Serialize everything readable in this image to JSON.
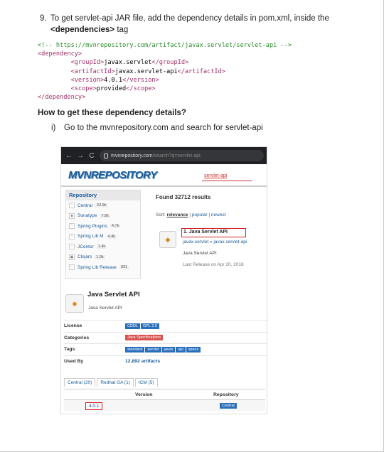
{
  "step": {
    "number": "9.",
    "text_a": "To get servlet-api JAR file, add the dependency details in pom.xml, inside the",
    "text_bold": "<dependencies>",
    "text_b": " tag"
  },
  "code": {
    "comment": "<!-- https://mvnrepository.com/artifact/javax.servlet/servlet-api -->",
    "open_dependency": "<dependency>",
    "groupId_open": "<groupId>",
    "groupId_value": "javax.servlet",
    "groupId_close": "</groupId>",
    "artifactId_open": "<artifactId>",
    "artifactId_value": "javax.servlet-api",
    "artifactId_close": "</artifactId>",
    "version_open": "<version>",
    "version_value": "4.0.1",
    "version_close": "</version>",
    "scope_open": "<scope>",
    "scope_value": "provided",
    "scope_close": "</scope>",
    "close_dependency": "</dependency>"
  },
  "question": "How to get these dependency details?",
  "substep": {
    "numeral": "i)",
    "text": "Go to the mvnrepository.com and search for servlet-api"
  },
  "screenshot": {
    "browser": {
      "back": "←",
      "forward": "→",
      "reload": "C",
      "url_host": "mvnrepository.com",
      "url_path": "/search?q=servlet-api"
    },
    "logo": "MVNREPOSITORY",
    "search_value": "servlet-api",
    "sidebar": {
      "title": "Repository",
      "items": [
        {
          "label": "Central",
          "count": "23.9k",
          "icon": "~"
        },
        {
          "label": "Sonatype",
          "count": "7.8k",
          "icon": "■"
        },
        {
          "label": "Spring Plugins",
          "count": "4.7k",
          "icon": "~"
        },
        {
          "label": "Spring Lib M",
          "count": "4.4k",
          "icon": "~"
        },
        {
          "label": "JCenter",
          "count": "1.4k",
          "icon": "▫"
        },
        {
          "label": "Clojars",
          "count": "1.0k",
          "icon": "▣"
        },
        {
          "label": "Spring Lib Release",
          "count": "931",
          "icon": "~"
        }
      ]
    },
    "results_count": "Found 32712 results",
    "sort": {
      "prefix": "Sort:",
      "active": "relevance",
      "sep1": "|",
      "opt2": "popular",
      "sep2": "|",
      "opt3": "newest"
    },
    "result": {
      "title": "1. Java Servlet API",
      "path": "javax.servlet » javax.servlet-api",
      "description": "Java Servlet API",
      "date": "Last Release on Apr 20, 2018"
    },
    "artifact": {
      "title": "Java Servlet API",
      "subtitle": "Java Servlet API"
    },
    "info": {
      "license_label": "License",
      "license_tags": [
        "CDDL",
        "GPL 2.0"
      ],
      "categories_label": "Categories",
      "category_tag": "Java Specifications",
      "tags_label": "Tags",
      "tags": [
        "standard",
        "servlet",
        "javax",
        "api",
        "specs"
      ],
      "used_by_label": "Used By",
      "used_by_value": "12,892 artifacts"
    },
    "tabs": [
      "Central (20)",
      "Redhat GA (1)",
      "ICM (5)"
    ],
    "table": {
      "col_version": "Version",
      "col_repository": "Repository",
      "row_version": "4.0.1",
      "row_repo": "Central"
    }
  }
}
